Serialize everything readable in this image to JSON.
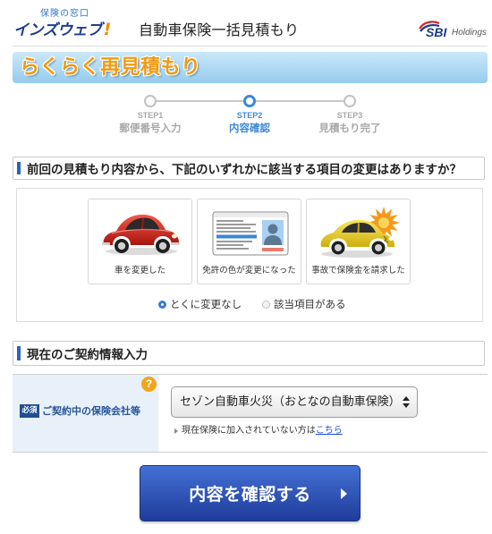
{
  "header": {
    "logo_tagline": "保険の窓口",
    "logo_name": "インズウェブ",
    "logo_mark": "!",
    "title": "自動車保険一括見積もり",
    "partner_name": "SBI",
    "partner_suffix": "Holdings"
  },
  "banner": {
    "title": "らくらく再見積もり"
  },
  "steps": [
    {
      "step": "STEP1",
      "label": "郵便番号入力",
      "active": false
    },
    {
      "step": "STEP2",
      "label": "内容確認",
      "active": true
    },
    {
      "step": "STEP3",
      "label": "見積もり完了",
      "active": false
    }
  ],
  "changes": {
    "question": "前回の見積もり内容から、下記のいずれかに該当する項目の変更はありますか？",
    "options": [
      {
        "label": "車を変更した",
        "icon": "red-car-icon"
      },
      {
        "label": "免許の色が変更になった",
        "icon": "license-card-icon"
      },
      {
        "label": "事故で保険金を請求した",
        "icon": "accident-car-icon"
      }
    ],
    "radios": [
      {
        "label": "とくに変更なし",
        "checked": true
      },
      {
        "label": "該当項目がある",
        "checked": false
      }
    ]
  },
  "contract": {
    "heading": "現在のご契約情報入力",
    "required_badge": "必須",
    "field_label": "ご契約中の保険会社等",
    "help_glyph": "?",
    "help_icon": "help-icon",
    "select_value": "セゾン自動車火災（おとなの自動車保険）",
    "select_arrow_icon": "select-arrows-icon",
    "note_arrow_icon": "triangle-right-icon",
    "note_text": "現在保険に加入されていない方は",
    "note_link": "こちら"
  },
  "submit": {
    "label": "内容を確認する",
    "arrow_icon": "chevron-right-icon"
  },
  "colors": {
    "brand_navy": "#1d3f8f",
    "step_active": "#3d8ad6",
    "step_inactive": "#a8a8a8",
    "help_orange": "#f0a51c",
    "required_badge": "#214e92",
    "button_blue": "#2b4fb3",
    "banner_text": "#f29a12",
    "link_blue": "#1a4fd0"
  }
}
